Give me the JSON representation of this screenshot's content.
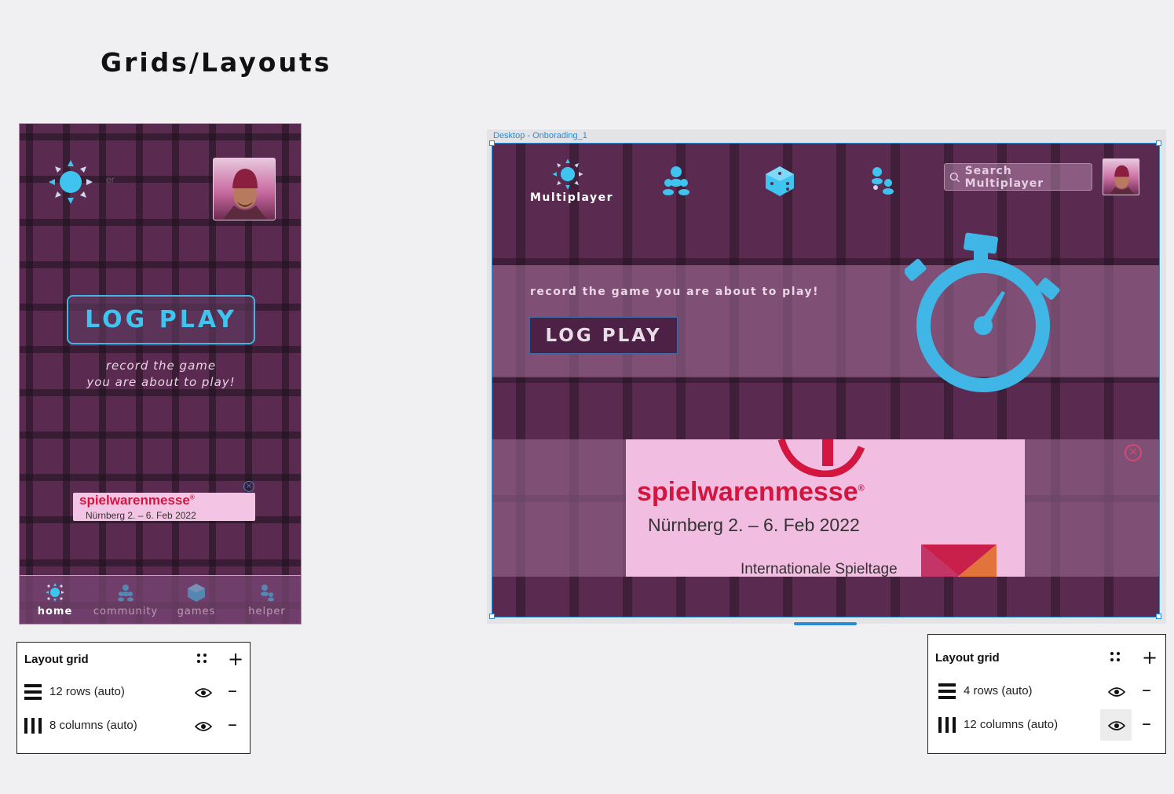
{
  "page": {
    "title": "Grids/Layouts"
  },
  "mobile": {
    "ghost_text": "er",
    "log_play": "LOG PLAY",
    "record_line1": "record the game",
    "record_line2": "you are about to play!",
    "ad": {
      "brand": "spielwarenmesse",
      "reg": "®",
      "sub": "Nürnberg 2. – 6. Feb 2022"
    },
    "nav": [
      {
        "label": "home",
        "icon": "sun-icon",
        "active": true
      },
      {
        "label": "community",
        "icon": "community-icon"
      },
      {
        "label": "games",
        "icon": "dice-icon"
      },
      {
        "label": "helper",
        "icon": "helper-icon"
      }
    ]
  },
  "desktop": {
    "frame_label": "Desktop - Onborading_1",
    "brand": "Multiplayer",
    "search_placeholder": "Search Multiplayer",
    "hero_text": "record the game you are about to play!",
    "log_play": "LOG PLAY",
    "ad": {
      "brand": "spielwarenmesse",
      "reg": "®",
      "sub": "Nürnberg 2. – 6. Feb 2022",
      "foot": "Internationale Spieltage"
    }
  },
  "panel_mobile": {
    "heading": "Layout grid",
    "rows": "12 rows (auto)",
    "cols": "8 columns (auto)"
  },
  "panel_desktop": {
    "heading": "Layout grid",
    "rows": "4 rows (auto)",
    "cols": "12 columns (auto)"
  },
  "colors": {
    "purple": "#5a2a50",
    "accent": "#3fc4f0",
    "selection": "#2b8ad6",
    "brand_red": "#d3163f"
  }
}
